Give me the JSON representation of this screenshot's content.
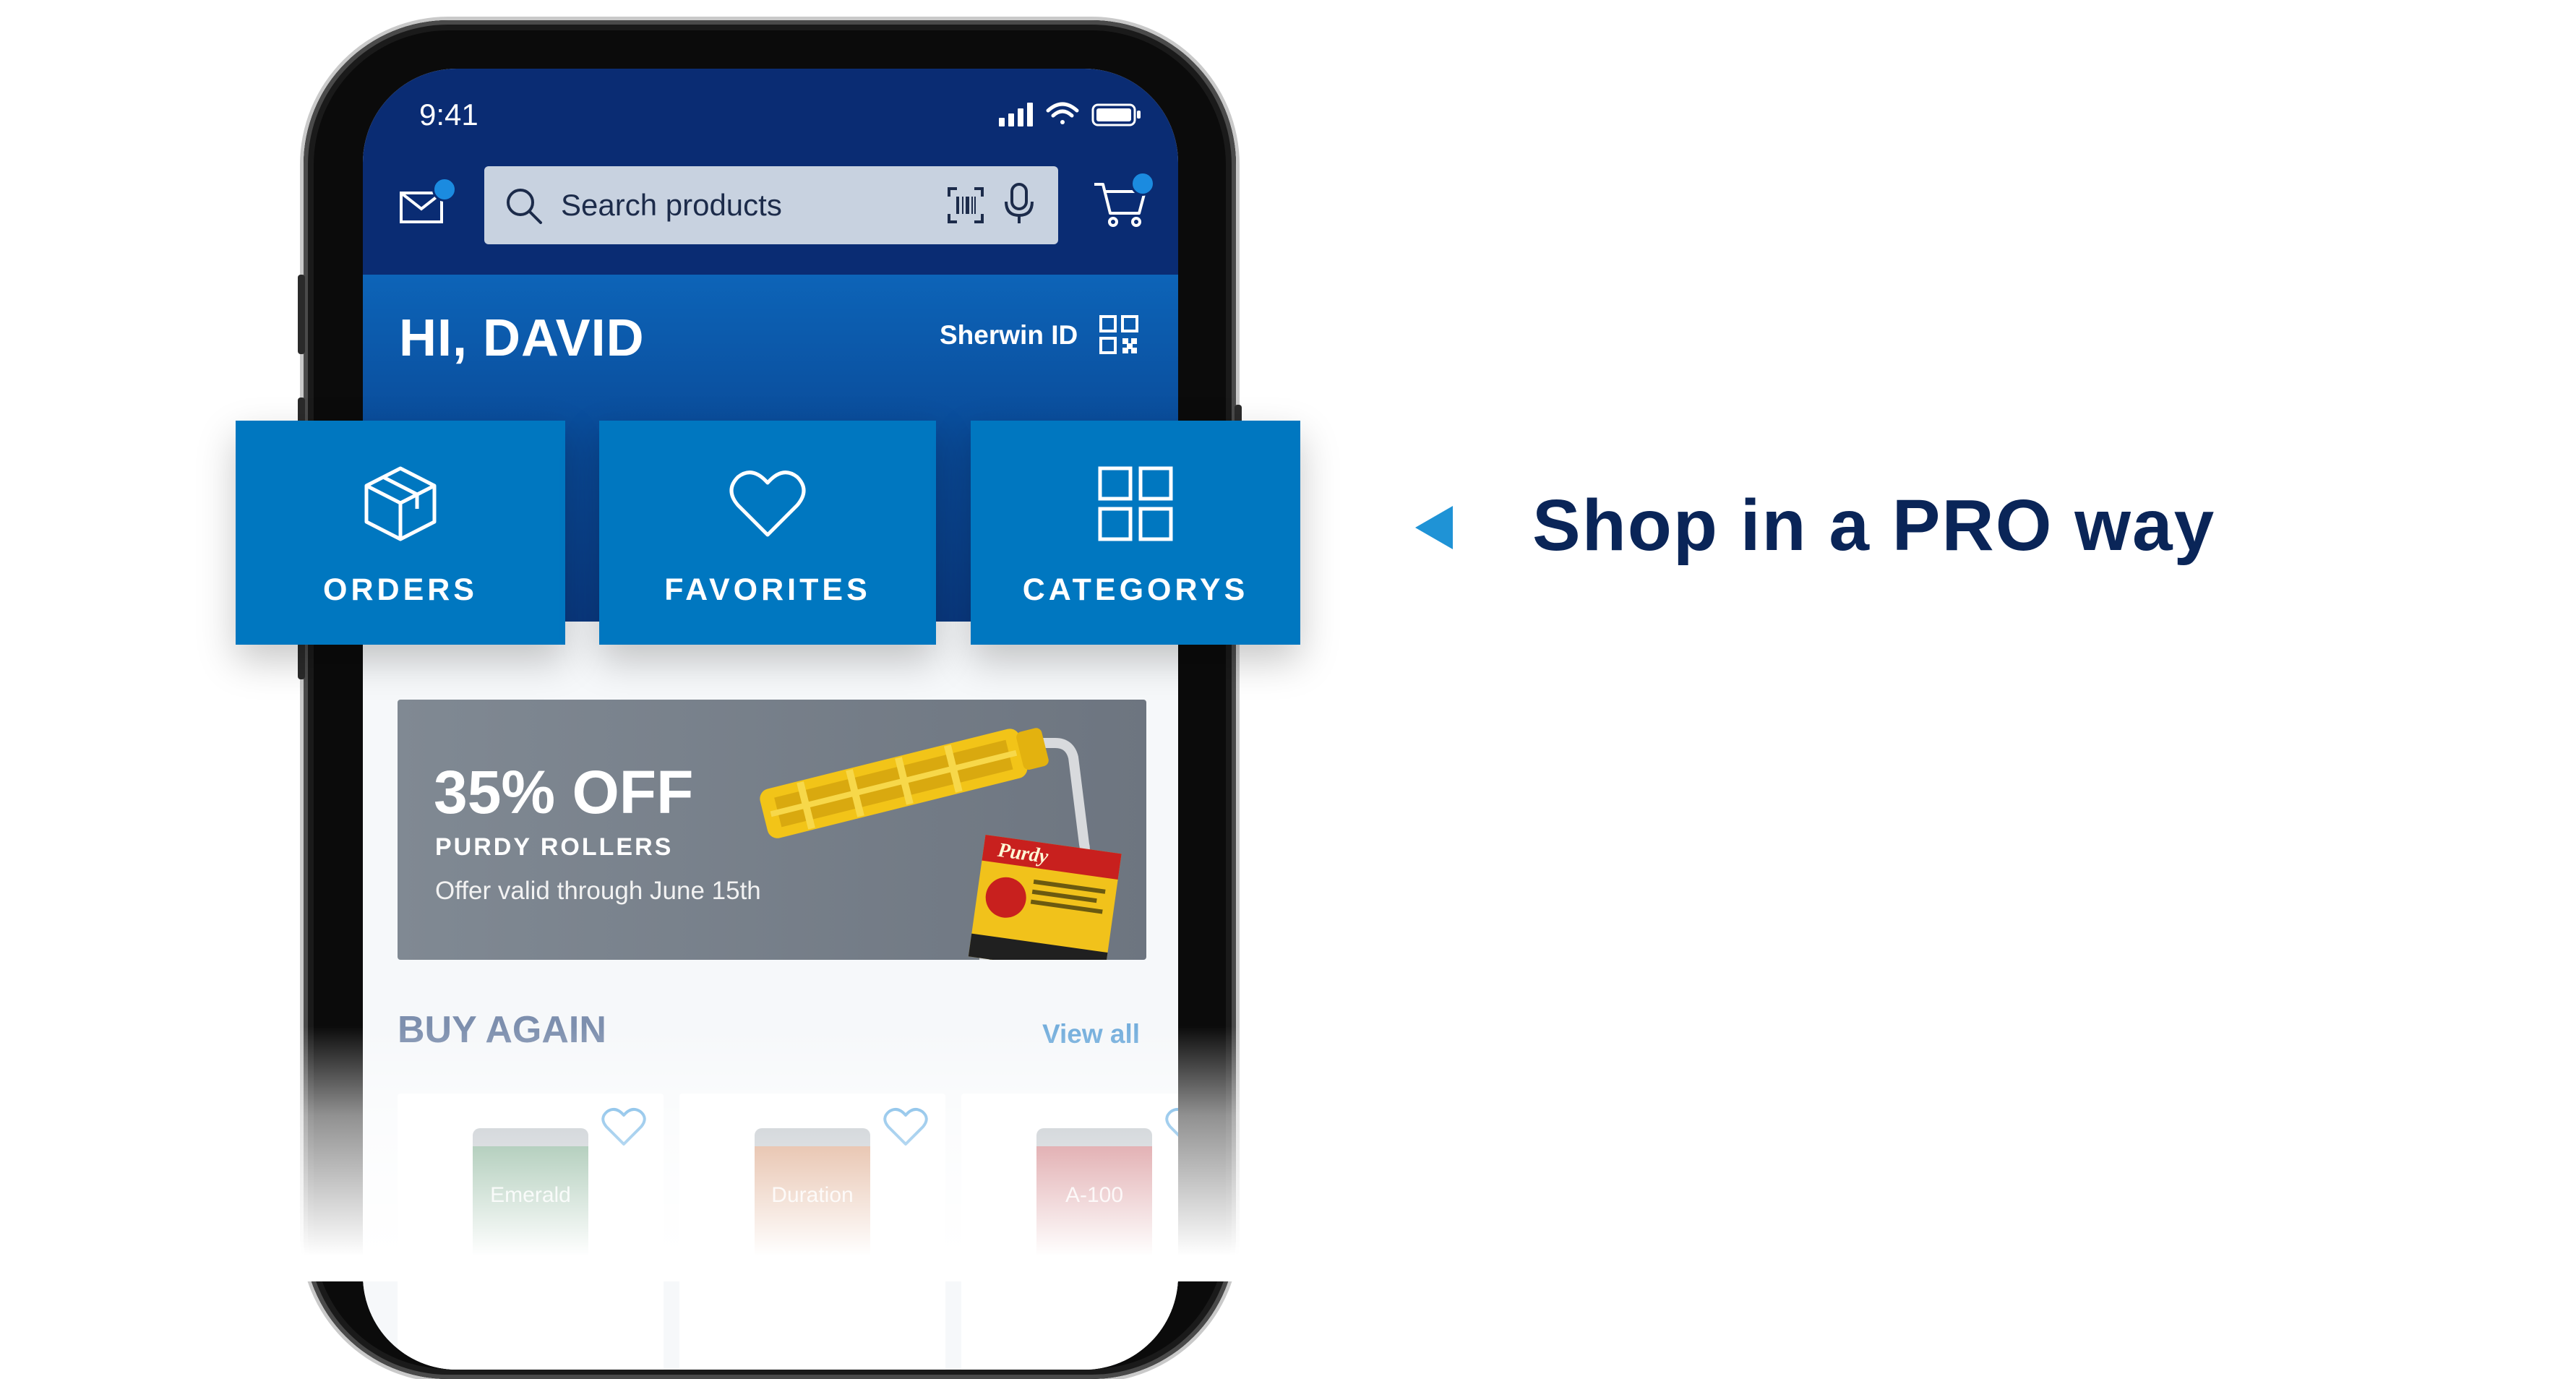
{
  "status_bar": {
    "time": "9:41"
  },
  "header": {
    "search": {
      "placeholder": "Search products"
    }
  },
  "hero": {
    "greeting": "HI, DAVID",
    "sherwin_id_label": "Sherwin ID"
  },
  "tiles": [
    {
      "label": "ORDERS",
      "icon": "box-icon"
    },
    {
      "label": "FAVORITES",
      "icon": "heart-icon"
    },
    {
      "label": "CATEGORYS",
      "icon": "grid-icon"
    }
  ],
  "promo": {
    "title": "35% OFF",
    "subtitle": "PURDY ROLLERS",
    "note": "Offer valid through June 15th",
    "package_brand": "Purdy"
  },
  "buy_again": {
    "title": "BUY AGAIN",
    "view_all": "View all",
    "products": [
      {
        "name": "Emerald",
        "color": "#2f7a4a"
      },
      {
        "name": "Duration",
        "color": "#c2622b"
      },
      {
        "name": "A-100",
        "color": "#b0252d"
      }
    ]
  },
  "callout": {
    "headline": "Shop in a PRO way"
  },
  "colors": {
    "navy": "#0a2c73",
    "tile_blue": "#0077c0",
    "accent_dot": "#1b8be0",
    "headline": "#0a2558"
  }
}
